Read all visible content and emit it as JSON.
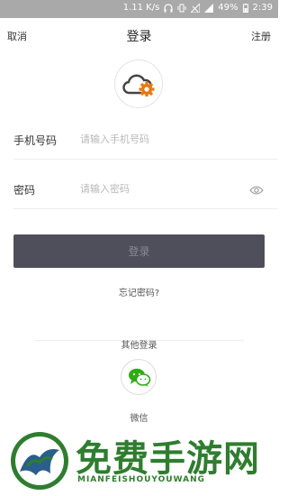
{
  "status_bar": {
    "speed": "1.11 K/s",
    "battery": "49%",
    "time": "2:39"
  },
  "nav": {
    "cancel": "取消",
    "title": "登录",
    "register": "注册"
  },
  "form": {
    "phone_label": "手机号码",
    "phone_placeholder": "请输入手机号码",
    "password_label": "密码",
    "password_placeholder": "请输入密码"
  },
  "login_button": "登录",
  "forgot_password": "忘记密码?",
  "other_login": "其他登录",
  "wechat_label": "微信",
  "watermark": {
    "title": "免费手游网",
    "subtitle": "MIANFEISHOUYOUWANG"
  },
  "colors": {
    "accent_orange": "#e8770e",
    "button_bg": "#4f4f5b",
    "wechat_green": "#2bad13",
    "watermark_green": "#2f7d2f"
  }
}
